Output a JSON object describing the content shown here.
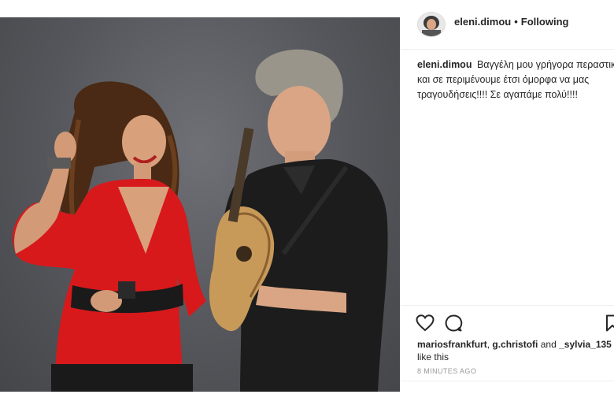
{
  "post": {
    "photo_description": "post-photo",
    "header": {
      "username": "eleni.dimou",
      "separator": "•",
      "follow_status": "Following"
    },
    "caption": {
      "username": "eleni.dimou",
      "text": "Βαγγέλη μου γρήγορα περαστικά και σε περιμένουμε έτσι όμορφα να μας τραγουδήσεις!!!! Σε αγαπάμε πολύ!!!!"
    },
    "actions": {
      "like_icon": "heart-icon",
      "comment_icon": "comment-icon",
      "save_icon": "bookmark-icon"
    },
    "likes": {
      "user1": "mariosfrankfurt",
      "comma": ",",
      "user2": "g.christofi",
      "and": "and",
      "user3": "_sylvia_135",
      "suffix": "like this"
    },
    "timestamp": "8 MINUTES AGO"
  }
}
